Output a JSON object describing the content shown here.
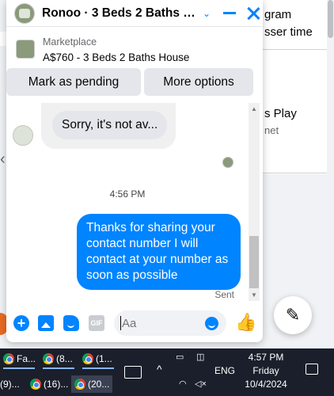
{
  "background": {
    "item1": "gram",
    "item2": "sser time",
    "item3": "s Play",
    "item4": "net"
  },
  "chat": {
    "header": {
      "title": "Ronoo · 3 Beds 2 Baths Ho..."
    },
    "marketplace": {
      "label": "Marketplace",
      "listing": "A$760 - 3 Beds 2 Baths House",
      "mark_pending": "Mark as pending",
      "more_options": "More options"
    },
    "messages": {
      "received": "Sorry, it's not av...",
      "timestamp": "4:56 PM",
      "sent": "Thanks for sharing your contact number I will contact at your number as soon as possible",
      "sent_status": "Sent"
    },
    "composer": {
      "placeholder": "Aa",
      "gif_label": "GIF"
    }
  },
  "taskbar": {
    "items": [
      "Fa...",
      "(8...",
      "(1...",
      "(9)...",
      "(16)...",
      "(20..."
    ],
    "language": "ENG",
    "clock_time": "4:57 PM",
    "clock_day": "Friday",
    "clock_date": "10/4/2024"
  },
  "colors": {
    "messenger_blue": "#0084ff",
    "taskbar": "#1a1f2b"
  }
}
